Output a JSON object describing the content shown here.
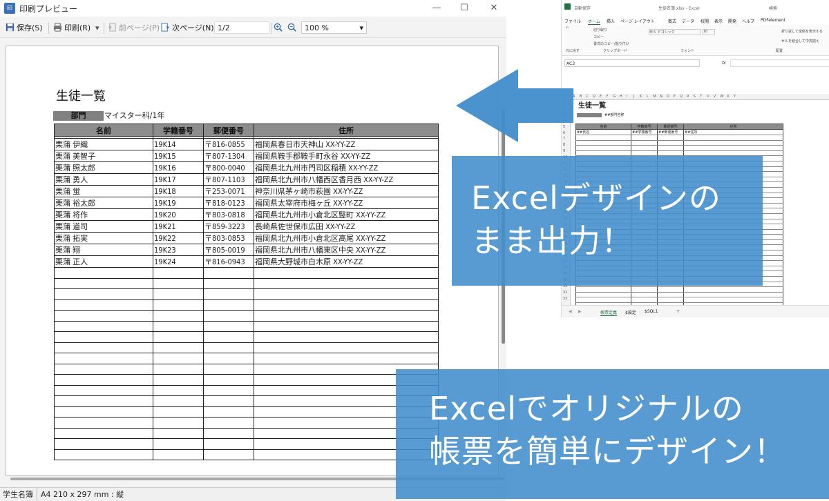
{
  "preview_window": {
    "title": "印刷プレビュー",
    "app_icon_text": "印",
    "controls": {
      "minimize": "—",
      "maximize": "☐",
      "close": "✕"
    },
    "toolbar": {
      "save": "保存(S)",
      "print": "印刷(R)",
      "prev_page": "前ページ(P)",
      "next_page": "次ページ(N)",
      "page_indicator": "1/2",
      "zoom_value": "100 %",
      "dropdown_caret": "▾"
    },
    "status_bar": {
      "doc_name": "学生名簿",
      "paper": "A4 210 x 297 mm : 縦"
    }
  },
  "document": {
    "title": "生徒一覧",
    "dept_label": "部門",
    "dept_value": "マイスター科/1年",
    "columns": [
      "名前",
      "学籍番号",
      "郵便番号",
      "住所"
    ],
    "rows": [
      [
        "栗蒲 伊織",
        "19K14",
        "〒816-0855",
        "福岡県春日市天神山 XX-YY-ZZ"
      ],
      [
        "栗蒲 美智子",
        "19K15",
        "〒807-1304",
        "福岡県鞍手郡鞍手町永谷 XX-YY-ZZ"
      ],
      [
        "栗蒲 照太郎",
        "19K16",
        "〒800-0040",
        "福岡県北九州市門司区稲積 XX-YY-ZZ"
      ],
      [
        "栗蒲 勇人",
        "19K17",
        "〒807-1103",
        "福岡県北九州市八幡西区香月西 XX-YY-ZZ"
      ],
      [
        "栗蒲 蛍",
        "19K18",
        "〒253-0071",
        "神奈川県茅ヶ崎市萩園 XX-YY-ZZ"
      ],
      [
        "栗蒲 裕太郎",
        "19K19",
        "〒818-0123",
        "福岡県太宰府市梅ヶ丘 XX-YY-ZZ"
      ],
      [
        "栗蒲 将作",
        "19K20",
        "〒803-0818",
        "福岡県北九州市小倉北区竪町 XX-YY-ZZ"
      ],
      [
        "栗蒲 道司",
        "19K21",
        "〒859-3223",
        "長崎県佐世保市広田 XX-YY-ZZ"
      ],
      [
        "栗蒲 拓実",
        "19K22",
        "〒803-0853",
        "福岡県北九州市小倉北区高尾 XX-YY-ZZ"
      ],
      [
        "栗蒲 翔",
        "19K23",
        "〒805-0019",
        "福岡県北九州市八幡東区中央 XX-YY-ZZ"
      ],
      [
        "栗蒲 正人",
        "19K24",
        "〒816-0943",
        "福岡県大野城市白木原 XX-YY-ZZ"
      ]
    ],
    "empty_rows": 18
  },
  "excel_window": {
    "title": "生徒名簿.xlsx - Excel",
    "autosave_label": "自動保存",
    "search_placeholder": "検索",
    "ribbon_tabs": [
      "ファイル",
      "ホーム",
      "挿入",
      "ページ レイアウト",
      "数式",
      "データ",
      "校閲",
      "表示",
      "開発",
      "ヘルプ",
      "PDFelement"
    ],
    "ribbon_items": {
      "cut": "切り取り",
      "copy": "コピー",
      "format_painter": "書式のコピー/貼り付け",
      "clipboard_group": "クリップボード",
      "font_name": "ＭＳ Ｐゴシック",
      "font_size": "10",
      "font_group": "フォント",
      "wrap_text": "折り返して全体を表示する",
      "merge_center": "セルを結合して中央揃え",
      "alignment_group": "配置",
      "undo_group": "元に戻す"
    },
    "name_box": "AC3",
    "fx_label": "fx",
    "column_letters": [
      "A",
      "B",
      "C",
      "D",
      "E",
      "F",
      "G",
      "H",
      "I",
      "J",
      "K",
      "L",
      "M",
      "N",
      "O",
      "P",
      "Q",
      "R",
      "S",
      "T",
      "U",
      "V",
      "W",
      "X",
      "Y"
    ],
    "sheet_title": "生徒一覧",
    "dept_text": "##部門名称",
    "header_row": [
      "名前",
      "学籍番号",
      "郵便番号",
      "住所"
    ],
    "template_row": [
      "##氏名",
      "##学籍番号",
      "##郵便番号",
      "##住所"
    ],
    "sheet_tabs": [
      "帳票定義",
      "$設定",
      "$SQL1",
      "+"
    ]
  },
  "overlays": {
    "banner_top": "Excelデザインの\nまま出力！",
    "banner_bottom": "Excelでオリジナルの\n帳票を簡単にデザイン！",
    "accent_color": "#418dcc"
  }
}
